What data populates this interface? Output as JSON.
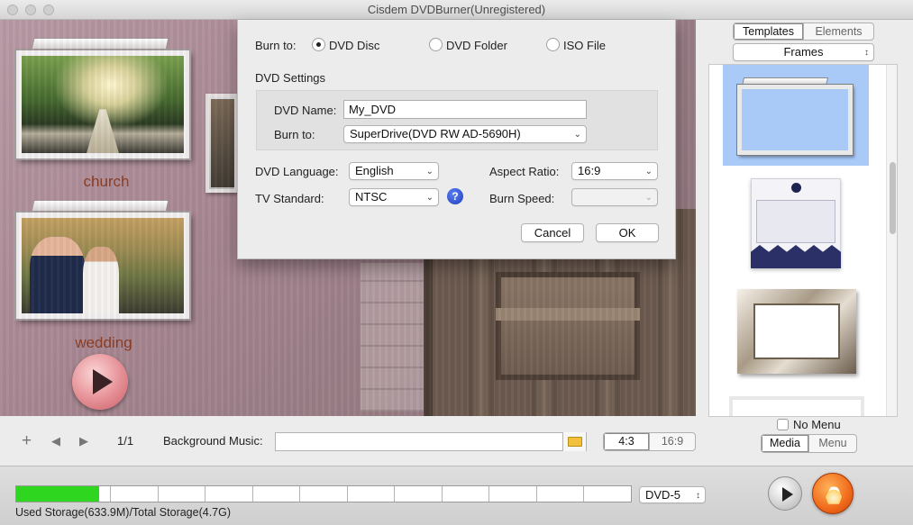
{
  "window": {
    "title": "Cisdem DVDBurner(Unregistered)"
  },
  "preview": {
    "thumbnails": [
      {
        "label": "church"
      },
      {
        "label": "wedding"
      }
    ]
  },
  "dialog": {
    "burn_to_label": "Burn to:",
    "options": [
      {
        "label": "DVD Disc",
        "selected": true
      },
      {
        "label": "DVD Folder",
        "selected": false
      },
      {
        "label": "ISO File",
        "selected": false
      }
    ],
    "settings_title": "DVD Settings",
    "dvd_name_label": "DVD Name:",
    "dvd_name_value": "My_DVD",
    "burn_device_label": "Burn to:",
    "burn_device_value": "SuperDrive(DVD RW AD-5690H)",
    "language_label": "DVD Language:",
    "language_value": "English",
    "aspect_label": "Aspect Ratio:",
    "aspect_value": "16:9",
    "tv_label": "TV Standard:",
    "tv_value": "NTSC",
    "speed_label": "Burn Speed:",
    "speed_value": "",
    "help_glyph": "?",
    "cancel_label": "Cancel",
    "ok_label": "OK"
  },
  "right_panel": {
    "tabs": [
      "Templates",
      "Elements"
    ],
    "active_tab": "Templates",
    "category_value": "Frames",
    "no_menu_label": "No Menu",
    "mode_tabs": [
      "Media",
      "Menu"
    ],
    "active_mode": "Media"
  },
  "controls": {
    "add_glyph": "+",
    "prev_glyph": "◀",
    "next_glyph": "▶",
    "page_indicator": "1/1",
    "bg_music_label": "Background Music:",
    "bg_music_value": "",
    "ratio_options": [
      "4:3",
      "16:9"
    ],
    "active_ratio": "4:3"
  },
  "bottom": {
    "storage_text": "Used Storage(633.9M)/Total Storage(4.7G)",
    "storage_fraction": 0.135,
    "disc_type": "DVD-5"
  },
  "colors": {
    "storage_fill": "#2fd620",
    "template_selected": "#a9c9f7",
    "burn_button": "#f06a1a"
  }
}
